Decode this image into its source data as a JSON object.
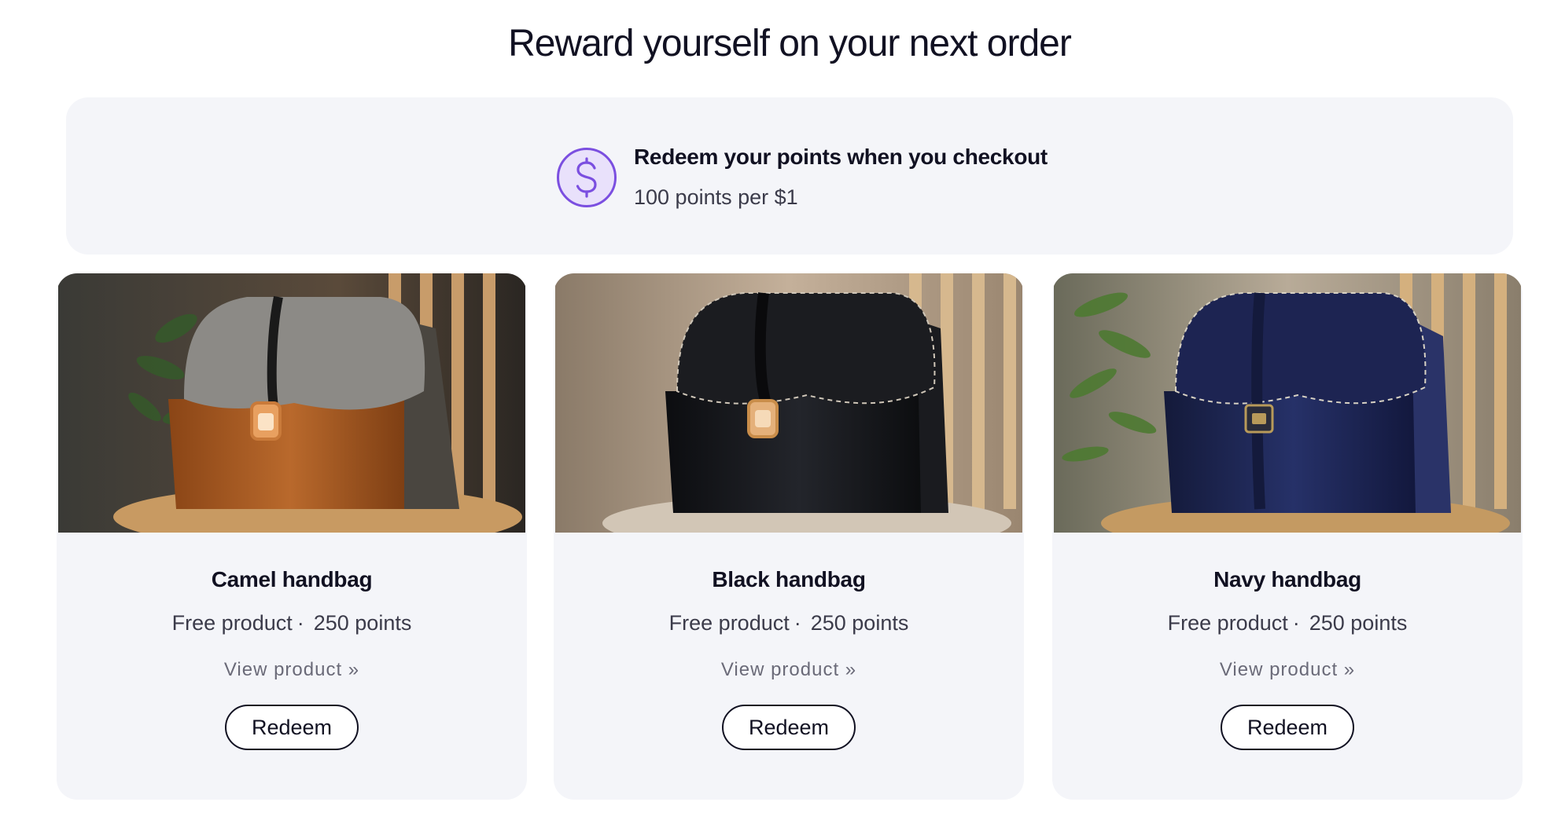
{
  "header": {
    "title": "Reward yourself on your next order"
  },
  "banner": {
    "icon": "dollar-circle-icon",
    "heading": "Redeem your points when you checkout",
    "subtext": "100 points per $1",
    "accent_color": "#7b4fe0"
  },
  "products": [
    {
      "name": "Camel handbag",
      "type": "Free product",
      "separator": "·",
      "points": "250 points",
      "link": "View product »",
      "button": "Redeem",
      "color": "#a0561f"
    },
    {
      "name": "Black handbag",
      "type": "Free product",
      "separator": "·",
      "points": "250 points",
      "link": "View product »",
      "button": "Redeem",
      "color": "#16181c"
    },
    {
      "name": "Navy handbag",
      "type": "Free product",
      "separator": "·",
      "points": "250 points",
      "link": "View product »",
      "button": "Redeem",
      "color": "#1f2a55"
    }
  ]
}
